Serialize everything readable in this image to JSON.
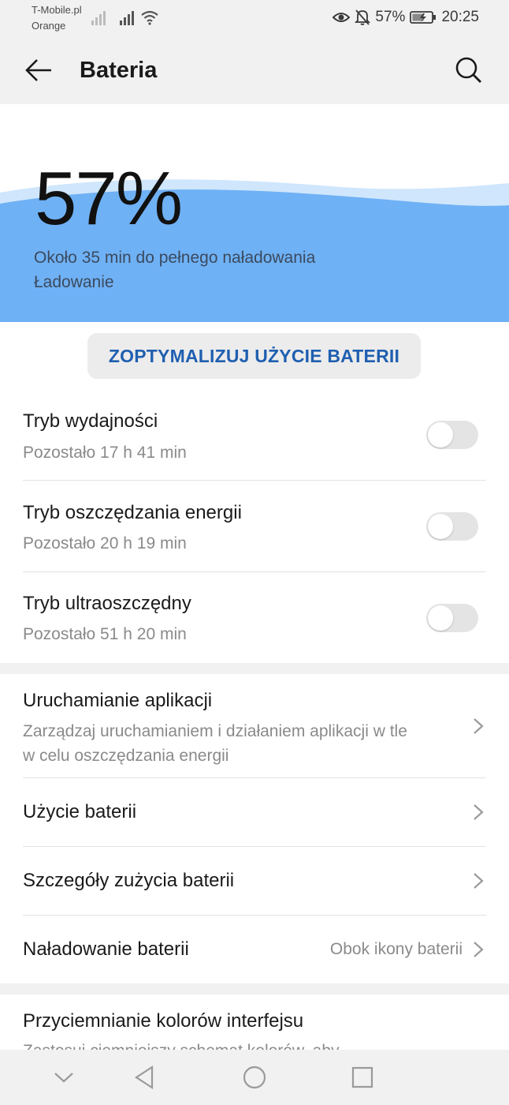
{
  "status_bar": {
    "carrier1": "T-Mobile.pl",
    "carrier2": "Orange",
    "battery_pct": "57%",
    "time": "20:25"
  },
  "app_bar": {
    "title": "Bateria"
  },
  "battery": {
    "percent": "57%",
    "eta": "Około 35 min do pełnego naładowania",
    "status": "Ładowanie",
    "wave_color": "#6fb1f5"
  },
  "optimize_button": "ZOPTYMALIZUJ UŻYCIE BATERII",
  "modes": [
    {
      "title": "Tryb wydajności",
      "subtitle": "Pozostało 17 h 41 min",
      "enabled": false
    },
    {
      "title": "Tryb oszczędzania energii",
      "subtitle": "Pozostało 20 h 19 min",
      "enabled": false
    },
    {
      "title": "Tryb ultraoszczędny",
      "subtitle": "Pozostało 51 h 20 min",
      "enabled": false
    }
  ],
  "settings": [
    {
      "title": "Uruchamianie aplikacji",
      "subtitle_line1": "Zarządzaj uruchamianiem i działaniem aplikacji w tle",
      "subtitle_line2": "w celu oszczędzania energii"
    },
    {
      "title": "Użycie baterii"
    },
    {
      "title": "Szczegóły zużycia baterii"
    },
    {
      "title": "Naładowanie baterii",
      "value": "Obok ikony baterii"
    }
  ],
  "section3": {
    "title": "Przyciemnianie kolorów interfejsu",
    "subtitle_partial": "Zastosuj ciemniejszy schemat kolorów, aby"
  },
  "colors": {
    "accent": "#1f5fb0",
    "wave": "#6fb1f5"
  }
}
